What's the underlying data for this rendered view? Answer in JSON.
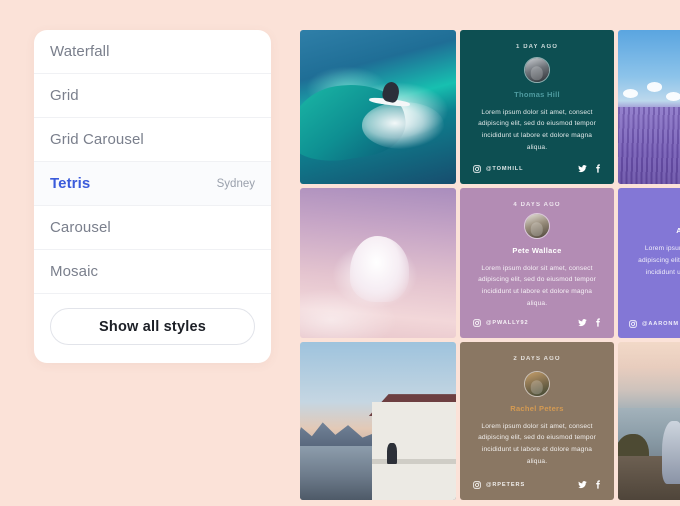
{
  "background_color": "#fbe2d8",
  "sidebar": {
    "accent_color": "#3b5bdb",
    "options": [
      {
        "label": "Waterfall",
        "meta": "",
        "active": false
      },
      {
        "label": "Grid",
        "meta": "",
        "active": false
      },
      {
        "label": "Grid Carousel",
        "meta": "",
        "active": false
      },
      {
        "label": "Tetris",
        "meta": "Sydney",
        "active": true
      },
      {
        "label": "Carousel",
        "meta": "",
        "active": false
      },
      {
        "label": "Mosaic",
        "meta": "",
        "active": false
      }
    ],
    "show_all_button": "Show all styles"
  },
  "grid": {
    "body_text": "Lorem ipsum dolor sit amet, consect adipiscing elit, sed do eiusmod tempor incididunt ut labore et dolore magna aliqua.",
    "photos": [
      {
        "name": "surfer-riding-wave"
      },
      {
        "name": "lavender-field-blue-sky"
      },
      {
        "name": "pink-cloud-sky"
      },
      {
        "name": "fjord-house-at-dusk"
      },
      {
        "name": "coastal-overlook-sunset"
      }
    ],
    "cards": [
      {
        "time": "1 DAY AGO",
        "name": "Thomas Hill",
        "handle": "@TOMHILL",
        "text": "Lorem ipsum dolor sit amet, consect adipiscing elit, sed do eiusmod tempor incididunt ut labore et dolore magna aliqua.",
        "background_color": "#0d4f52",
        "name_color": "#4e9ba0"
      },
      {
        "time": "4 DAYS AGO",
        "name": "Pete Wallace",
        "handle": "@PWALLY92",
        "text": "Lorem ipsum dolor sit amet, consect adipiscing elit, sed do eiusmod tempor incididunt ut labore et dolore magna aliqua.",
        "background_color": "#b38cb4",
        "name_color": "#ffffff"
      },
      {
        "time": "2 DAYS AGO",
        "name": "Rachel Peters",
        "handle": "@RPETERS",
        "text": "Lorem ipsum dolor sit amet, consect adipiscing elit, sed do eiusmod tempor incididunt ut labore et dolore magna aliqua.",
        "background_color": "#8a7763",
        "name_color": "#d49a52"
      },
      {
        "time": "",
        "name": "A",
        "handle": "@AARONM",
        "text": "Lorem ipsum dolor sit amet, consect adipiscing elit, sed do eiusmod tempor incididunt ut labore et dolore magna aliqua.",
        "background_color": "#8377d6",
        "name_color": "#ffffff"
      }
    ],
    "social_icons": [
      "instagram-icon",
      "twitter-icon",
      "facebook-icon"
    ]
  }
}
